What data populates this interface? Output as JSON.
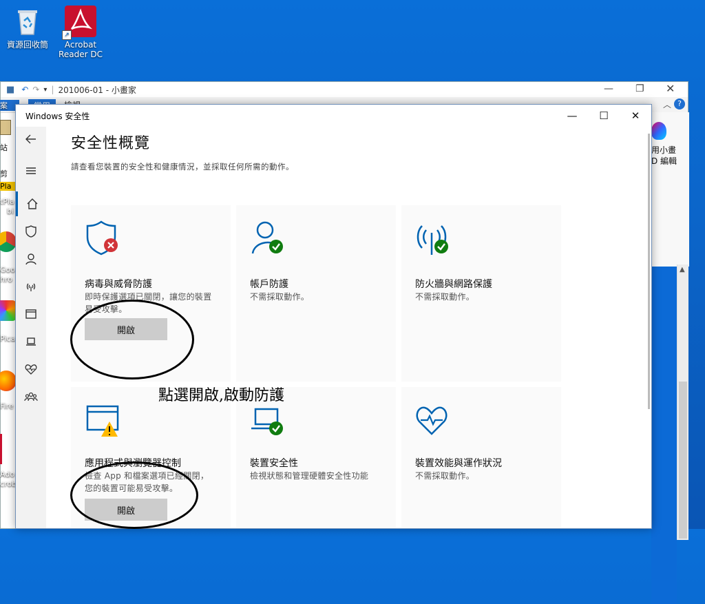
{
  "desktop": {
    "icons": [
      {
        "name": "recycle-bin",
        "label": "資源回收筒"
      },
      {
        "name": "acrobat",
        "label": "Acrobat Reader DC"
      }
    ],
    "left_stubs": [
      "案",
      "站",
      "剪",
      "Pla",
      "tPla",
      "bi",
      "Goo",
      "hro",
      "Picas",
      "Fire",
      "Ado",
      "crob"
    ]
  },
  "paint_window": {
    "title": "201006-01 - 小畫家",
    "ribbon_tab": "常用",
    "ribbon_tab2": "檢視",
    "right_label1": "用小畫",
    "right_label2": "D 編輯"
  },
  "security_window": {
    "title": "Windows 安全性",
    "page_title": "安全性概覽",
    "page_subtitle": "請查看您裝置的安全性和健康情況，並採取任何所需的動作。",
    "cards": [
      {
        "title": "病毒與威脅防護",
        "desc": "即時保護選項已關閉，讓您的裝置易受攻擊。",
        "button": "開啟",
        "status": "error"
      },
      {
        "title": "帳戶防護",
        "desc": "不需採取動作。",
        "status": "ok"
      },
      {
        "title": "防火牆與網路保護",
        "desc": "不需採取動作。",
        "status": "ok"
      },
      {
        "title": "應用程式與瀏覽器控制",
        "desc": "檢查 App 和檔案選項已經關閉，您的裝置可能易受攻擊。",
        "button": "開啟",
        "status": "warning"
      },
      {
        "title": "裝置安全性",
        "desc": "檢視狀態和管理硬體安全性功能",
        "status": "ok"
      },
      {
        "title": "裝置效能與運作狀況",
        "desc": "不需採取動作。",
        "status": "ok"
      }
    ]
  },
  "annotation": {
    "text": "點選開啟,啟動防護"
  },
  "colors": {
    "accent": "#0063b1",
    "ok": "#107c10",
    "error": "#d13438",
    "warning": "#ffb900"
  }
}
